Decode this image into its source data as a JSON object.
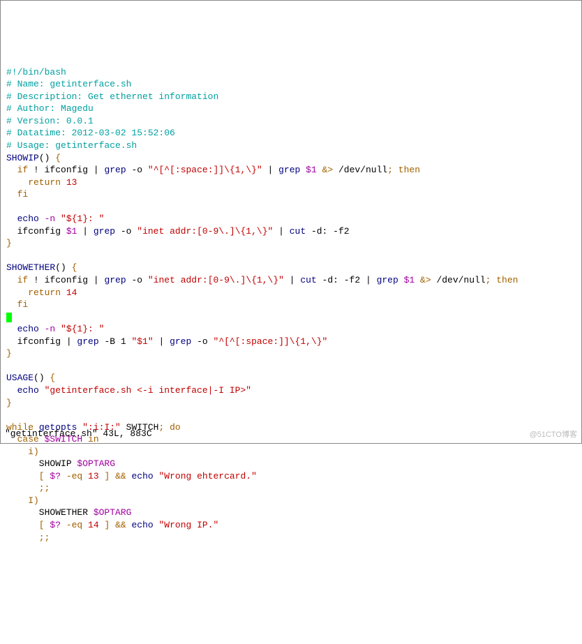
{
  "header": {
    "shebang": "#!/bin/bash",
    "name": "# Name: getinterface.sh",
    "desc": "# Description: Get ethernet information",
    "author": "# Author: Magedu",
    "version": "# Version: 0.0.1",
    "datetime": "# Datatime: 2012-03-02 15:52:06",
    "usage": "# Usage: getinterface.sh"
  },
  "fn1": {
    "name": "SHOWIP",
    "parens": "()",
    "brace_open": " {",
    "if_kw": "  if",
    "bang": " ! ",
    "ifc": "ifconfig",
    "pipe1": " | ",
    "grep": "grep",
    "opt_o": " -o ",
    "regex1": "\"^[^[:space:]]\\{1,\\}\"",
    "pipe2": " | ",
    "var1": " $1 ",
    "redir": "&>",
    "devnull": " /dev/null",
    "semi_then": "; then",
    "ret_kw": "    return",
    "ret_val": " 13",
    "fi_kw": "  fi",
    "echo_kw": "  echo",
    "echo_opt": " -n ",
    "echo_str": "\"${1}: \"",
    "ifc2": "  ifconfig",
    "var2": " $1 ",
    "regex2": "\"inet addr:[0-9\\.]\\{1,\\}\"",
    "cut": "cut",
    "cut_opt": " -d: -f2",
    "brace_close": "}"
  },
  "fn2": {
    "name": "SHOWETHER",
    "parens": "()",
    "brace_open": " {",
    "if_kw": "  if",
    "bang": " ! ",
    "ifc": "ifconfig",
    "pipe1": " | ",
    "grep": "grep",
    "opt_o": " -o ",
    "regex1": "\"inet addr:[0-9\\.]\\{1,\\}\"",
    "pipe2": " | ",
    "cut": "cut",
    "cut_opt": " -d: -f2 ",
    "var1": " $1 ",
    "redir": "&>",
    "devnull": " /dev/null",
    "semi_then": "; then",
    "ret_kw": "    return",
    "ret_val": " 14",
    "fi_kw": "  fi",
    "echo_kw": "  echo",
    "echo_opt": " -n ",
    "echo_str": "\"${1}: \"",
    "ifc2": "  ifconfig",
    "opt_b": " -B 1 ",
    "str1": "\"$1\"",
    "regex2": "\"^[^[:space:]]\\{1,\\}\"",
    "brace_close": "}"
  },
  "fn3": {
    "name": "USAGE",
    "parens": "()",
    "brace_open": " {",
    "echo_kw": "  echo",
    "echo_str": " \"getinterface.sh <-i interface|-I IP>\"",
    "brace_close": "}"
  },
  "loop": {
    "while_kw": "while",
    "getopts": " getopts ",
    "optstr": "\":i:I:\"",
    "switch": " SWITCH",
    "semi": "; ",
    "do_kw": "do",
    "case_kw": "  case",
    "case_var": " $SWITCH ",
    "in_kw": "in",
    "pat_i": "    i)",
    "call1": "      SHOWIP ",
    "optarg1": "$OPTARG",
    "test1_open": "      [ ",
    "test1_var": "$?",
    "test1_eq": " -eq ",
    "test1_val": "13",
    "test1_close": " ] ",
    "and": "&&",
    "echo1_kw": " echo ",
    "echo1_str": "\"Wrong ehtercard.\"",
    "dsemi1": "      ;;",
    "pat_I": "    I)",
    "call2": "      SHOWETHER ",
    "optarg2": "$OPTARG",
    "test2_open": "      [ ",
    "test2_var": "$?",
    "test2_eq": " -eq ",
    "test2_val": "14",
    "test2_close": " ] ",
    "echo2_kw": " echo ",
    "echo2_str": "\"Wrong IP.\"",
    "dsemi2": "      ;;"
  },
  "status": "\"getinterface.sh\" 43L, 883C",
  "watermark": "@51CTO博客"
}
